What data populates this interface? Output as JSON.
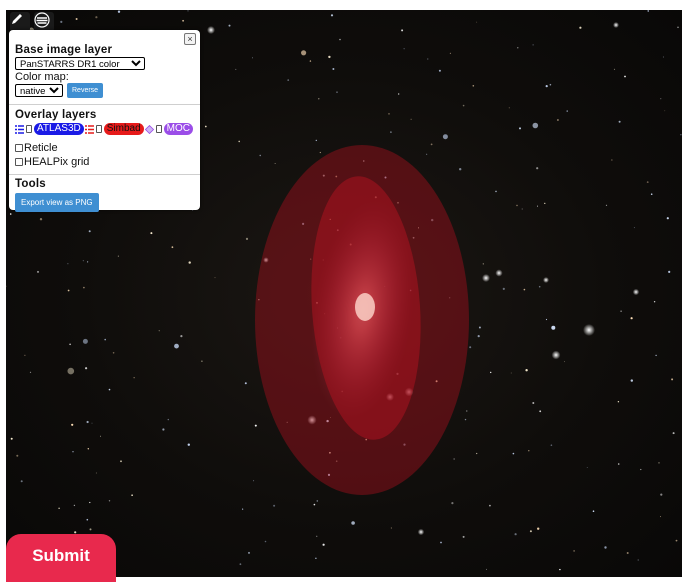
{
  "toolbar": {
    "edit_icon": "pencil-icon",
    "layers_icon": "layers-icon"
  },
  "panel": {
    "close_label": "×",
    "base_layer": {
      "title": "Base image layer",
      "survey_selected": "PanSTARRS DR1 color",
      "color_map_label": "Color map:",
      "color_map_selected": "native",
      "reverse_label": "Reverse"
    },
    "overlay": {
      "title": "Overlay layers",
      "catalogs": [
        {
          "label": "ATLAS3D",
          "color": "#1a1ae6"
        },
        {
          "label": "Simbad",
          "color": "#e61a1a"
        },
        {
          "label": "MOC",
          "color": "#9b4de8"
        }
      ],
      "reticle_label": "Reticle",
      "healpix_label": "HEALPix grid"
    },
    "tools": {
      "title": "Tools",
      "export_label": "Export view as PNG"
    }
  },
  "submit_label": "Submit",
  "colors": {
    "accent_blue": "#3f8fd2",
    "submit_red": "#e8294d",
    "overlay_red": "#b3121f"
  }
}
